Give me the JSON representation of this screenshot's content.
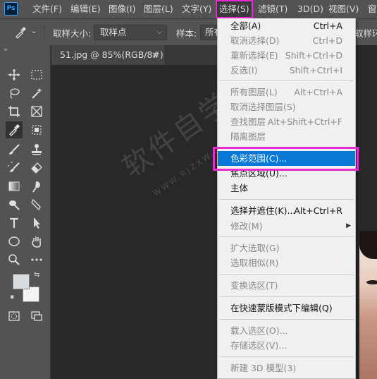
{
  "app": {
    "logo": "Ps"
  },
  "menubar": {
    "items": [
      {
        "label": "文件(F)"
      },
      {
        "label": "编辑(E)"
      },
      {
        "label": "图像(I)"
      },
      {
        "label": "图层(L)"
      },
      {
        "label": "文字(Y)"
      },
      {
        "label": "选择(S)",
        "active": true
      },
      {
        "label": "滤镜(T)"
      },
      {
        "label": "3D(D)"
      },
      {
        "label": "视图(V)"
      },
      {
        "label": "窗"
      }
    ]
  },
  "options": {
    "sample_size_label": "取样大小:",
    "sample_size_value": "取样点",
    "sample_label": "样本:",
    "sample_value": "所有",
    "right_label": "取样环"
  },
  "document": {
    "tab_title": "51.jpg @ 85%(RGB/8#)",
    "close_symbol": "×"
  },
  "tools": [
    {
      "icon": "move-icon"
    },
    {
      "icon": "marquee-icon"
    },
    {
      "icon": "lasso-icon"
    },
    {
      "icon": "magic-wand-icon"
    },
    {
      "icon": "crop-icon"
    },
    {
      "icon": "frame-icon"
    },
    {
      "icon": "eyedropper-icon",
      "selected": true
    },
    {
      "icon": "object-select-icon"
    },
    {
      "icon": "brush-icon"
    },
    {
      "icon": "stamp-icon"
    },
    {
      "icon": "history-brush-icon"
    },
    {
      "icon": "eraser-icon"
    },
    {
      "icon": "gradient-icon"
    },
    {
      "icon": "smudge-icon"
    },
    {
      "icon": "dodge-icon"
    },
    {
      "icon": "pen-icon"
    },
    {
      "icon": "type-icon"
    },
    {
      "icon": "path-select-icon"
    },
    {
      "icon": "ellipse-icon"
    },
    {
      "icon": "hand-icon"
    },
    {
      "icon": "zoom-icon"
    },
    {
      "icon": "more-icon"
    }
  ],
  "dropdown": {
    "items": [
      {
        "label": "全部(A)",
        "shortcut": "Ctrl+A",
        "enabled": true
      },
      {
        "label": "取消选择(D)",
        "shortcut": "Ctrl+D",
        "enabled": false
      },
      {
        "label": "重新选择(E)",
        "shortcut": "Shift+Ctrl+D",
        "enabled": false
      },
      {
        "label": "反选(I)",
        "shortcut": "Shift+Ctrl+I",
        "enabled": false
      },
      {
        "label": "所有图层(L)",
        "shortcut": "Alt+Ctrl+A",
        "enabled": false
      },
      {
        "label": "取消选择图层(S)",
        "shortcut": "",
        "enabled": false
      },
      {
        "label": "查找图层",
        "shortcut": "Alt+Shift+Ctrl+F",
        "enabled": false
      },
      {
        "label": "隔离图层",
        "shortcut": "",
        "enabled": false
      },
      {
        "label": "色彩范围(C)...",
        "shortcut": "",
        "enabled": true,
        "highlight": true
      },
      {
        "label": "焦点区域(U)...",
        "shortcut": "",
        "enabled": true
      },
      {
        "label": "主体",
        "shortcut": "",
        "enabled": true
      },
      {
        "label": "选择并遮住(K)...",
        "shortcut": "Alt+Ctrl+R",
        "enabled": true
      },
      {
        "label": "修改(M)",
        "shortcut": "",
        "enabled": false,
        "submenu": true
      },
      {
        "label": "扩大选取(G)",
        "shortcut": "",
        "enabled": false
      },
      {
        "label": "选取相似(R)",
        "shortcut": "",
        "enabled": false
      },
      {
        "label": "变换选区(T)",
        "shortcut": "",
        "enabled": false
      },
      {
        "label": "在快速蒙版模式下编辑(Q)",
        "shortcut": "",
        "enabled": true
      },
      {
        "label": "载入选区(O)...",
        "shortcut": "",
        "enabled": false
      },
      {
        "label": "存储选区(V)...",
        "shortcut": "",
        "enabled": false
      },
      {
        "label": "新建 3D 模型(3)",
        "shortcut": "",
        "enabled": false
      }
    ],
    "submenu_arrow": "▶"
  },
  "watermark": {
    "text": "软件自学网",
    "subtext": "WWW.RJZXW.COM"
  },
  "colors": {
    "accent": "#e52ccf",
    "highlight": "#0a78d7"
  }
}
